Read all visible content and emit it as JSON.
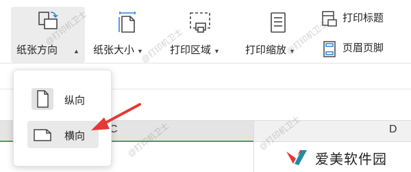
{
  "ribbon": {
    "paper_orientation": {
      "label": "纸张方向",
      "icon": "orientation-rotate-icon"
    },
    "paper_size": {
      "label": "纸张大小",
      "icon": "paper-size-icon"
    },
    "print_area": {
      "label": "打印区域",
      "icon": "print-area-icon"
    },
    "print_scale": {
      "label": "打印缩放",
      "icon": "print-scale-icon"
    },
    "print_titles": {
      "label": "打印标题",
      "icon": "print-titles-icon"
    },
    "header_footer": {
      "label": "页眉页脚",
      "icon": "header-footer-icon"
    }
  },
  "dropdown": {
    "items": [
      {
        "label": "纵向",
        "icon": "portrait-page-icon"
      },
      {
        "label": "横向",
        "icon": "landscape-page-icon"
      }
    ]
  },
  "sheet": {
    "columns": [
      "C",
      "D"
    ]
  },
  "watermark": {
    "text": "@打印机卫士"
  },
  "brand": {
    "text": "爱美软件园"
  },
  "colors": {
    "arrow": "#e53935",
    "selection_green": "#3aa655",
    "logo_red": "#e53935",
    "logo_teal": "#1e8ea0"
  }
}
